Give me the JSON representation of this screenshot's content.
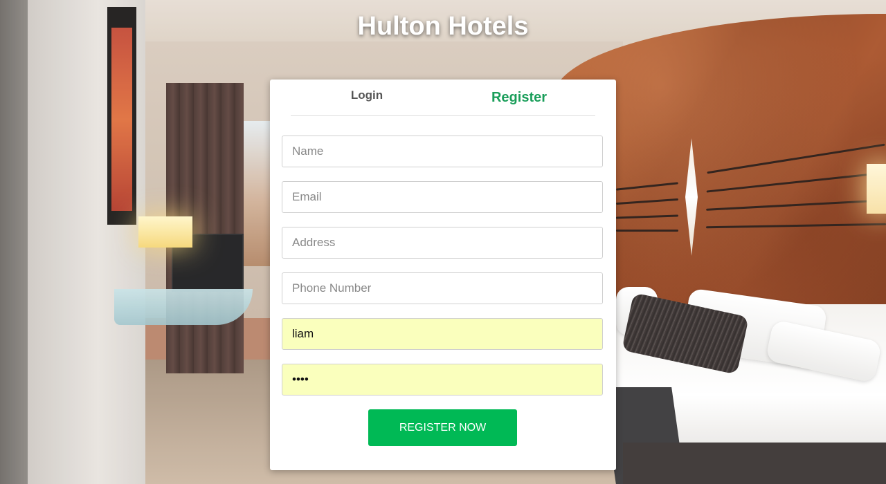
{
  "app": {
    "title": "Hulton Hotels"
  },
  "tabs": {
    "login_label": "Login",
    "register_label": "Register",
    "active": "register"
  },
  "form": {
    "name": {
      "placeholder": "Name",
      "value": ""
    },
    "email": {
      "placeholder": "Email",
      "value": ""
    },
    "address": {
      "placeholder": "Address",
      "value": ""
    },
    "phone": {
      "placeholder": "Phone Number",
      "value": ""
    },
    "username": {
      "value": "liam"
    },
    "password": {
      "value": "liam"
    },
    "submit_label": "REGISTER NOW"
  },
  "colors": {
    "accent": "#1a9e5a",
    "button": "#00b955",
    "autofill": "#faffbd"
  }
}
